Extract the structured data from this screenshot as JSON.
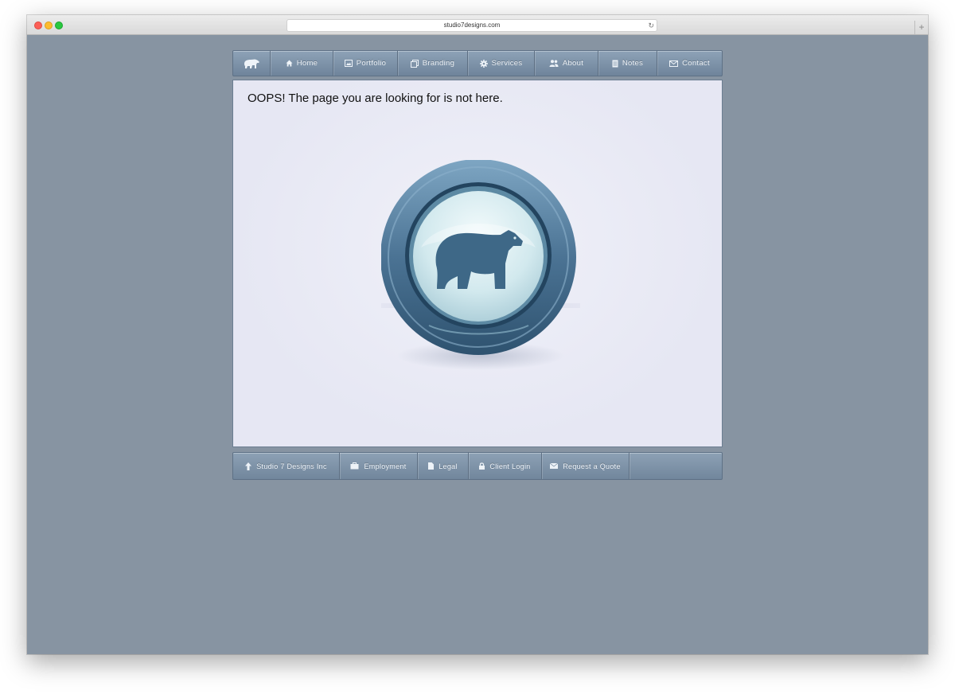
{
  "browser": {
    "url": "studio7designs.com",
    "new_tab_symbol": "+"
  },
  "nav": {
    "items": [
      {
        "label": "Home",
        "icon": "home-icon"
      },
      {
        "label": "Portfolio",
        "icon": "portfolio-icon"
      },
      {
        "label": "Branding",
        "icon": "branding-icon"
      },
      {
        "label": "Services",
        "icon": "gear-icon"
      },
      {
        "label": "About",
        "icon": "people-icon"
      },
      {
        "label": "Notes",
        "icon": "notes-icon"
      },
      {
        "label": "Contact",
        "icon": "mail-icon"
      }
    ]
  },
  "content": {
    "message": "OOPS! The page you are looking for is not here."
  },
  "footer": {
    "items": [
      {
        "label": "Studio 7 Designs Inc",
        "icon": "arrow-up-icon"
      },
      {
        "label": "Employment",
        "icon": "briefcase-icon"
      },
      {
        "label": "Legal",
        "icon": "document-icon"
      },
      {
        "label": "Client Login",
        "icon": "lock-icon"
      },
      {
        "label": "Request a Quote",
        "icon": "envelope-icon"
      }
    ]
  },
  "colors": {
    "page_background": "#8794a2",
    "nav_top": "#8ea2b7",
    "nav_bottom": "#6f849b",
    "content_background": "#e9eaf5",
    "emblem_ring": "#3f6584"
  }
}
